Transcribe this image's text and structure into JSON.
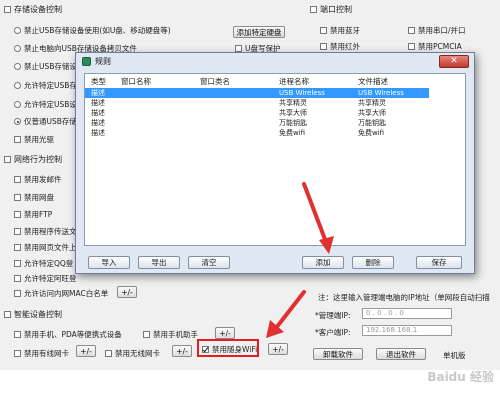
{
  "left_panel": {
    "storage_group_title": "存储设备控制",
    "storage_options": [
      {
        "label": "禁止USB存储设备使用(如U盘、移动硬盘等)",
        "checked": false
      },
      {
        "label": "禁止电脑向USB存储设备拷贝文件",
        "checked": false
      },
      {
        "label": "禁止USB存储设",
        "checked": false
      },
      {
        "label": "允许特定USB存",
        "checked": false
      },
      {
        "label": "允许特定USB设",
        "checked": false
      },
      {
        "label": "仅普通USB存储设",
        "checked": true
      }
    ],
    "add_disk_button": "添加特定硬盘",
    "u_disk_protect_label": "U盘写保护",
    "disable_cdrom_label": "禁用光驱",
    "network_group_title": "网络行为控制",
    "network_options": [
      "禁用发邮件",
      "禁用网盘",
      "禁用FTP",
      "禁用程序传送文",
      "禁用网页文件上",
      "允许特定QQ登",
      "允许特定阿旺登",
      "允许访问内网MAC白名单"
    ],
    "network_plusminus": "+/-",
    "smart_group_title": "智能设备控制",
    "smart_options": [
      {
        "label": "禁用手机、PDA等便携式设备",
        "checked": false
      },
      {
        "label": "禁用手机助手",
        "checked": false
      },
      {
        "label": "禁用有线网卡",
        "checked": false
      },
      {
        "label": "禁用无线网卡",
        "checked": false
      },
      {
        "label": "禁用随身WiFi",
        "checked": true
      }
    ],
    "plusminus": "+/-"
  },
  "right_panel": {
    "port_group_title": "端口控制",
    "port_options": [
      {
        "label": "禁用蓝牙",
        "checked": false
      },
      {
        "label": "禁用串口/并口",
        "checked": false
      },
      {
        "label": "禁用红外",
        "checked": false
      },
      {
        "label": "禁用PCMCIA",
        "checked": false
      }
    ],
    "note_text": "注：这里输入管理端电脑的IP地址（单网段自动扫描",
    "manager_ip_label": "*管理端IP:",
    "manager_ip_value": "0 . 0 . 0 . 0",
    "client_ip_label": "*客户端IP:",
    "client_ip_value": "192.168.168.1",
    "uninstall_button": "卸载软件",
    "exit_button": "退出软件",
    "standalone_label": "单机版"
  },
  "dialog": {
    "title": "规则",
    "close_glyph": "✕",
    "columns": [
      "类型",
      "窗口名称",
      "窗口类名",
      "进程名称",
      "文件描述"
    ],
    "rows": [
      {
        "type": "描述",
        "window": "",
        "class": "",
        "process": "USB Wireless",
        "desc": "USB Wireless",
        "selected": true
      },
      {
        "type": "描述",
        "window": "",
        "class": "",
        "process": "共享精灵",
        "desc": "共享精灵",
        "selected": false
      },
      {
        "type": "描述",
        "window": "",
        "class": "",
        "process": "共享大师",
        "desc": "共享大师",
        "selected": false
      },
      {
        "type": "描述",
        "window": "",
        "class": "",
        "process": "万能钥匙",
        "desc": "万能钥匙",
        "selected": false
      },
      {
        "type": "描述",
        "window": "",
        "class": "",
        "process": "免费wifi",
        "desc": "免费wifi",
        "selected": false
      }
    ],
    "buttons": {
      "import": "导入",
      "export": "导出",
      "clear": "清空",
      "add": "添加",
      "delete": "删除",
      "save": "保存"
    }
  },
  "watermark": "Baidu 经验",
  "colors": {
    "highlight": "#e02020",
    "selection": "#3399ff",
    "arrow": "#e03030"
  }
}
